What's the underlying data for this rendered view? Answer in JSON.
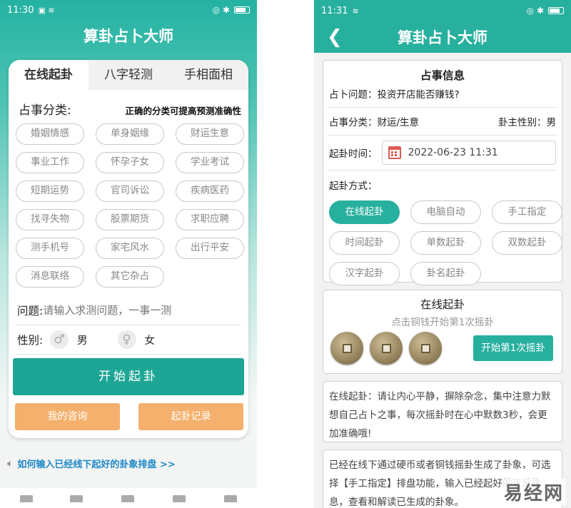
{
  "left": {
    "status": {
      "time": "11:30",
      "icons": "◎ ✱"
    },
    "title": "算卦占卜大师",
    "tabs": [
      {
        "label": "在线起卦"
      },
      {
        "label": "八字轻测"
      },
      {
        "label": "手相面相"
      }
    ],
    "category_title": "占事分类:",
    "category_hint": "正确的分类可提高预测准确性",
    "categories": [
      "婚姻情感",
      "单身姻缘",
      "财运生意",
      "事业工作",
      "怀孕子女",
      "学业考试",
      "短期运势",
      "官司诉讼",
      "疾病医药",
      "找寻失物",
      "股票期货",
      "求职应聘",
      "测手机号",
      "家宅风水",
      "出行平安",
      "消息联络",
      "其它杂占"
    ],
    "question_label": "问题:",
    "question_placeholder": "请输入求测问题，一事一测",
    "gender_label": "性别:",
    "gender_male": "男",
    "gender_female": "女",
    "start_button": "开始起卦",
    "my_consult_button": "我的咨询",
    "records_button": "起卦记录",
    "help_link": "如何输入已经线下起好的卦象排盘 >>"
  },
  "right": {
    "status": {
      "time": "11:31",
      "icons": "◎ ✱"
    },
    "title": "算卦占卜大师",
    "info_title": "占事信息",
    "question_label": "占卜问题：",
    "question_value": "投资开店能否赚钱?",
    "category_label": "占事分类：",
    "category_value": "财运/生意",
    "gender_label": "卦主性别：",
    "gender_value": "男",
    "time_label": "起卦时间：",
    "time_value": "2022-06-23 11:31",
    "method_label": "起卦方式：",
    "methods": [
      "在线起卦",
      "电脑自动",
      "手工指定",
      "时间起卦",
      "单数起卦",
      "双数起卦",
      "汉字起卦",
      "卦名起卦"
    ],
    "online_title": "在线起卦",
    "online_subtitle": "点击铜钱开始第1次摇卦",
    "shake_button": "开始第1次摇卦",
    "tip_text": "在线起卦：请让内心平静，摒除杂念，集中注意力默想自己占卜之事，每次摇卦时在心中默数3秒，会更加准确哦!",
    "tip2_text": "已经在线下通过硬币或者铜钱摇卦生成了卦象，可选择【手工指定】排盘功能，输入已经起好的正反信息，查看和解读已生成的卦象。"
  },
  "watermark": "易经网",
  "colors": {
    "accent": "#28b09f",
    "orange": "#f4b06c",
    "link": "#1e88c8"
  }
}
